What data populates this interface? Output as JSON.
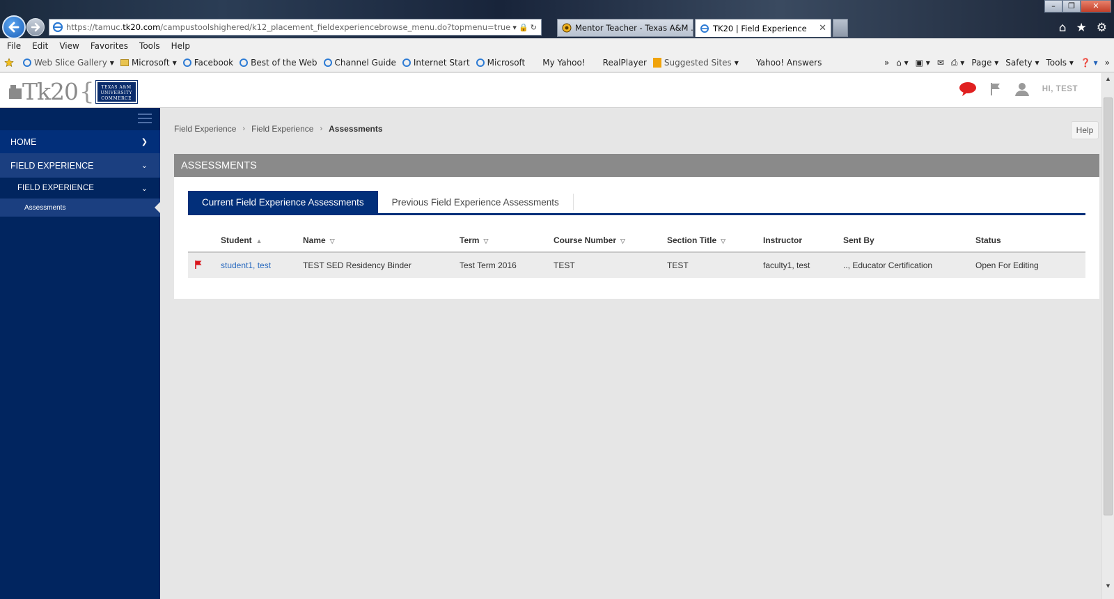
{
  "browser": {
    "address_url_prefix": "https://tamuc.",
    "address_url_host": "tk20.com",
    "address_url_path": "/campustoolshighered/k12_placement_fieldexperiencebrowse_menu.do?topmenu=true",
    "tabs": [
      {
        "title": "Mentor Teacher - Texas A&M ..."
      },
      {
        "title": "TK20 | Field Experience"
      }
    ],
    "menu": [
      "File",
      "Edit",
      "View",
      "Favorites",
      "Tools",
      "Help"
    ],
    "favorites": [
      "Web Slice Gallery",
      "Microsoft",
      "Facebook",
      "Best of the Web",
      "Channel Guide",
      "Internet Start",
      "Microsoft",
      "My Yahoo!",
      "RealPlayer",
      "Suggested Sites",
      "Yahoo! Answers"
    ],
    "command_bar": [
      "Page",
      "Safety",
      "Tools"
    ]
  },
  "header": {
    "logo_text": "Tk20",
    "university_badge": "TEXAS A&M UNIVERSITY COMMERCE",
    "greeting": "HI, TEST"
  },
  "sidebar": {
    "items": [
      {
        "label": "HOME"
      },
      {
        "label": "FIELD EXPERIENCE"
      },
      {
        "label": "FIELD EXPERIENCE"
      },
      {
        "label": "Assessments"
      }
    ]
  },
  "breadcrumb": [
    "Field Experience",
    "Field Experience",
    "Assessments"
  ],
  "help_label": "Help",
  "panel": {
    "title": "ASSESSMENTS",
    "tabs": [
      {
        "label": "Current Field Experience Assessments",
        "active": true
      },
      {
        "label": "Previous Field Experience Assessments",
        "active": false
      }
    ]
  },
  "table": {
    "columns": [
      "Student",
      "Name",
      "Term",
      "Course Number",
      "Section Title",
      "Instructor",
      "Sent By",
      "Status"
    ],
    "rows": [
      {
        "student": "student1, test",
        "name": "TEST SED Residency Binder",
        "term": "Test Term 2016",
        "course_number": "TEST",
        "section_title": "TEST",
        "instructor": "faculty1, test",
        "sent_by": ".., Educator Certification",
        "status": "Open For Editing"
      }
    ]
  },
  "colors": {
    "sidebar_bg": "#01255f",
    "active_tab": "#022f7a",
    "panel_header": "#8a8a8a",
    "link": "#2a6bbf",
    "flag": "#d9141b"
  }
}
